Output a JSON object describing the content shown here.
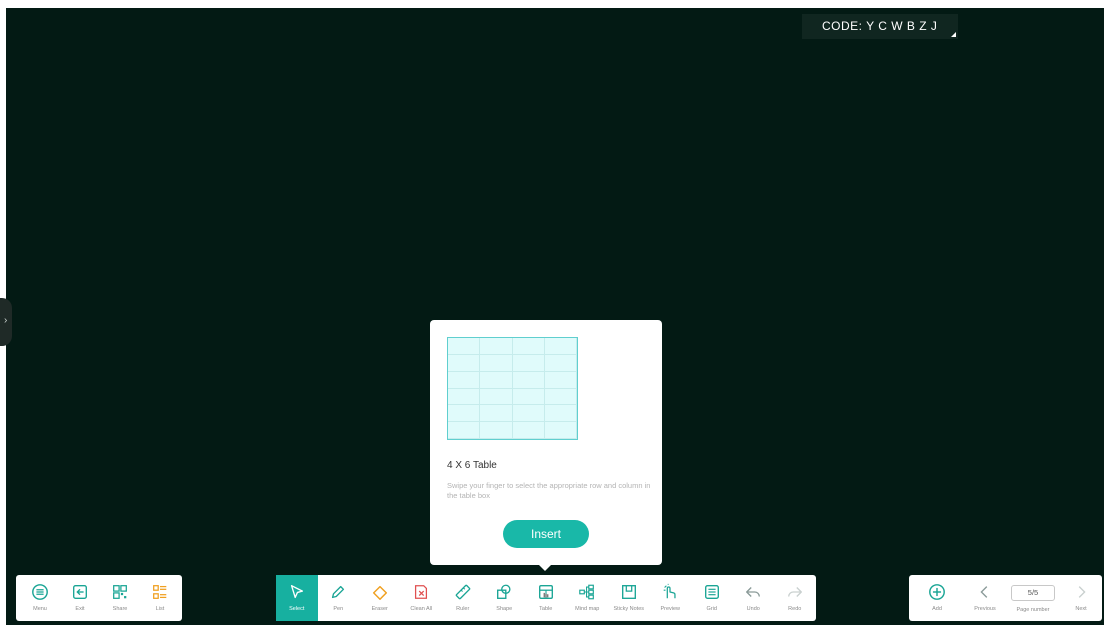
{
  "code_badge": {
    "text": "CODE: Y C W B Z J"
  },
  "side_handle": {
    "glyph": "›"
  },
  "table_popover": {
    "rows": 4,
    "columns": 6,
    "title": "4 X 6 Table",
    "hint": "Swipe your finger to select the appropriate row and column in the table box",
    "insert_label": "Insert"
  },
  "toolbar_left": [
    {
      "label": "Menu",
      "icon": "menu-icon"
    },
    {
      "label": "Exit",
      "icon": "exit-icon"
    },
    {
      "label": "Share",
      "icon": "qr-share-icon"
    },
    {
      "label": "List",
      "icon": "list-icon"
    }
  ],
  "toolbar_main": [
    {
      "label": "Select",
      "icon": "cursor-icon",
      "active": true
    },
    {
      "label": "Pen",
      "icon": "pen-icon"
    },
    {
      "label": "Eraser",
      "icon": "eraser-icon"
    },
    {
      "label": "Clean All",
      "icon": "clean-all-icon"
    },
    {
      "label": "Ruler",
      "icon": "ruler-icon"
    },
    {
      "label": "Shape",
      "icon": "shape-icon"
    },
    {
      "label": "Table",
      "icon": "table-icon"
    },
    {
      "label": "Mind map",
      "icon": "mind-map-icon"
    },
    {
      "label": "Sticky Notes",
      "icon": "sticky-notes-icon"
    },
    {
      "label": "Preview",
      "icon": "preview-hand-icon"
    },
    {
      "label": "Grid",
      "icon": "grid-icon"
    },
    {
      "label": "Undo",
      "icon": "undo-icon"
    },
    {
      "label": "Redo",
      "icon": "redo-icon"
    }
  ],
  "toolbar_right": {
    "add_label": "Add",
    "previous_label": "Previous",
    "page_value": "5/5",
    "page_number_label": "Page number",
    "next_label": "Next"
  },
  "colors": {
    "board": "#031a14",
    "accent": "#17b0a0",
    "orange": "#f0a020",
    "red": "#e05050",
    "icon_teal": "#1aa595"
  }
}
